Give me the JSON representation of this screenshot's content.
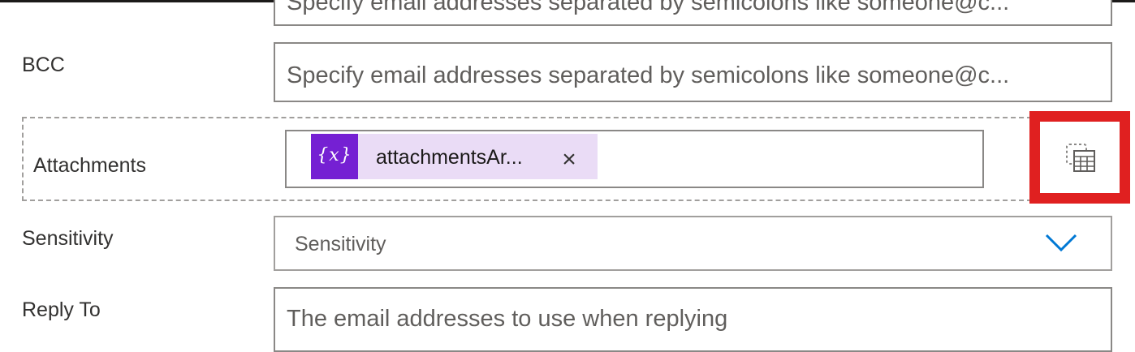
{
  "form": {
    "cc": {
      "placeholder": "Specify email addresses separated by semicolons like someone@c..."
    },
    "bcc": {
      "label": "BCC",
      "placeholder": "Specify email addresses separated by semicolons like someone@c..."
    },
    "attachments": {
      "label": "Attachments",
      "token": {
        "icon_text": "{x}",
        "icon_name": "variable-icon",
        "text": "attachmentsAr...",
        "remove_glyph": "×"
      },
      "picker_icon": "dynamic-content-picker-icon"
    },
    "sensitivity": {
      "label": "Sensitivity",
      "placeholder": "Sensitivity",
      "chevron_icon": "chevron-down-icon"
    },
    "reply_to": {
      "label": "Reply To",
      "placeholder": "The email addresses to use when replying"
    }
  },
  "colors": {
    "token_icon_bg": "#7520d3",
    "token_bg": "#eadcf6",
    "chevron": "#0078d4",
    "highlight": "#e02020",
    "field_border": "#8a8886"
  }
}
